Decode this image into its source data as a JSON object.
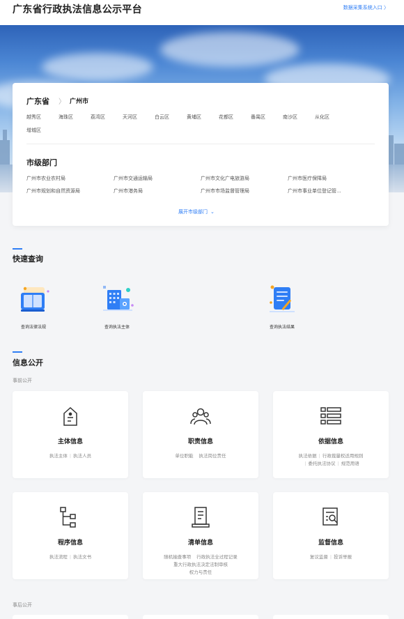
{
  "header": {
    "title": "广东省行政执法信息公示平台",
    "entry_label": "数据采集系统入口 〉"
  },
  "region": {
    "province": "广东省",
    "separator": "〉",
    "city": "广州市",
    "districts": [
      "越秀区",
      "海珠区",
      "荔湾区",
      "天河区",
      "白云区",
      "黄埔区",
      "花都区",
      "番禺区",
      "南沙区",
      "从化区",
      "增城区"
    ],
    "dept_title": "市级部门",
    "departments": [
      "广州市农业农村局",
      "广州市交通运输局",
      "广州市文化广电旅游局",
      "广州市医疗保障局",
      "广州市规划和自然资源局",
      "广州市港务局",
      "广州市市场监督管理局",
      "广州市事业单位登记管..."
    ],
    "expand_label": "展开市级部门",
    "expand_icon": "chevron-down-icon"
  },
  "quick_query": {
    "title": "快速查询",
    "items": [
      {
        "label": "查询法律法规",
        "icon": "law-book-icon"
      },
      {
        "label": "查询执法主体",
        "icon": "building-icon"
      },
      {
        "label": "查询执法结果",
        "icon": "result-document-icon"
      }
    ]
  },
  "info": {
    "title": "信息公开",
    "before_label": "事前公开",
    "after_label": "事后公开",
    "cards": [
      {
        "title": "主体信息",
        "lines": [
          [
            "执法主体",
            "执法人员"
          ]
        ],
        "icon": "house-document-icon"
      },
      {
        "title": "职责信息",
        "lines": [
          [
            "单位职能",
            "执法岗位责任"
          ]
        ],
        "icon": "people-group-icon"
      },
      {
        "title": "依据信息",
        "lines": [
          [
            "执法依据",
            "行政裁量权适用规则"
          ],
          [
            "委托执法协议",
            "规范用语"
          ]
        ],
        "icon": "list-icon"
      },
      {
        "title": "程序信息",
        "lines": [
          [
            "执法流程",
            "执法文书"
          ]
        ],
        "icon": "flowchart-icon"
      },
      {
        "title": "清单信息",
        "lines": [
          [
            "随机抽查事项",
            "行政执法全过程记录"
          ],
          [
            "重大行政执法决定法制审核"
          ],
          [
            "权力与责任"
          ]
        ],
        "icon": "checklist-icon"
      },
      {
        "title": "监督信息",
        "lines": [
          [
            "复议监督",
            "投诉举报"
          ]
        ],
        "icon": "supervision-document-icon"
      }
    ]
  },
  "colors": {
    "accent": "#2f7ef5",
    "background": "#f4f5f7"
  }
}
